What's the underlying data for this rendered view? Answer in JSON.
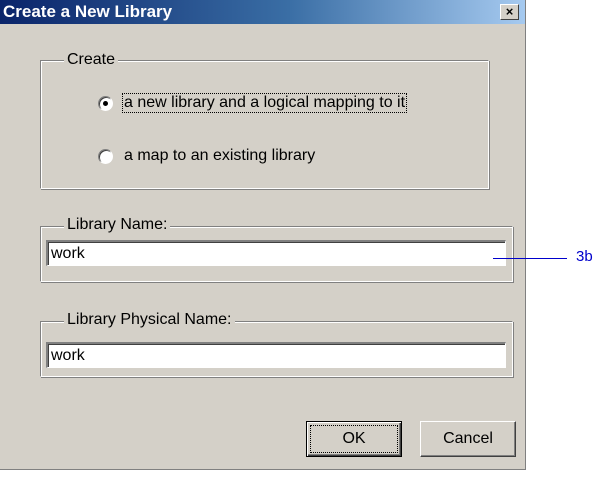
{
  "window": {
    "title": "Create a New Library",
    "close_glyph": "×"
  },
  "create_group": {
    "legend": "Create",
    "options": [
      {
        "label": "a new library and a logical mapping to it",
        "selected": true
      },
      {
        "label": "a map to an existing library",
        "selected": false
      }
    ]
  },
  "library_name": {
    "legend": "Library Name:",
    "value": "work"
  },
  "library_physical_name": {
    "legend": "Library Physical Name:",
    "value": "work"
  },
  "buttons": {
    "ok_label": "OK",
    "cancel_label": "Cancel"
  },
  "annotation": {
    "label": "3b",
    "color": "#0000cc"
  }
}
